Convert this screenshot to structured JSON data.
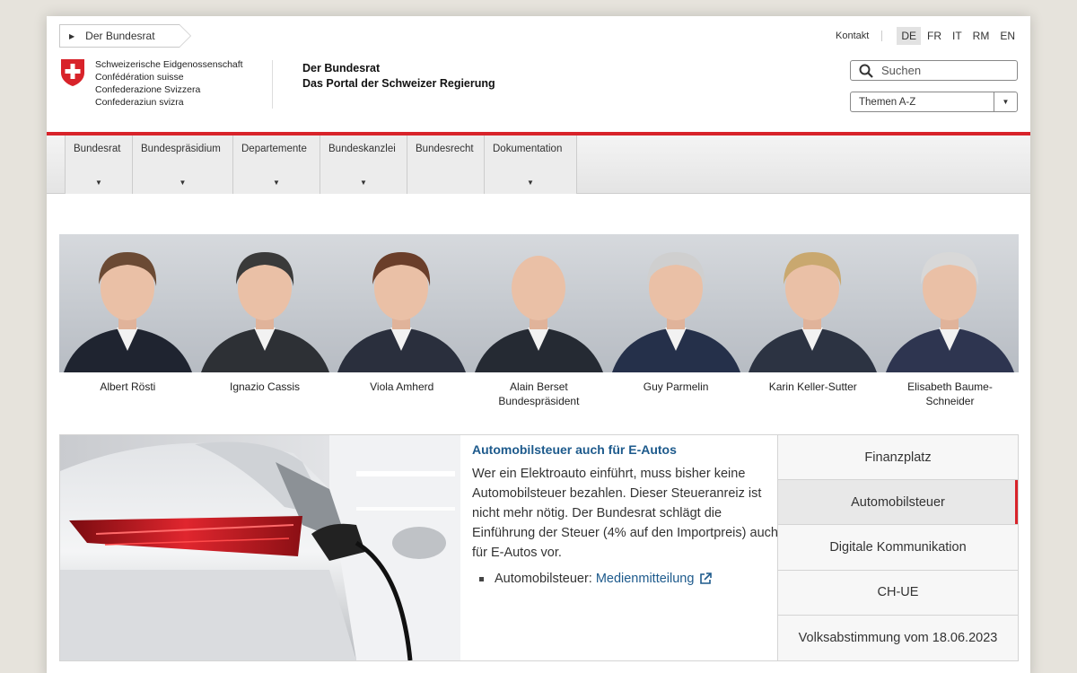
{
  "breadcrumb": {
    "label": "Der Bundesrat"
  },
  "confederation": {
    "lines": [
      "Schweizerische Eidgenossenschaft",
      "Confédération suisse",
      "Confederazione Svizzera",
      "Confederaziun svizra"
    ]
  },
  "portal": {
    "title": "Der Bundesrat",
    "subtitle": "Das Portal der Schweizer Regierung"
  },
  "header": {
    "contact": "Kontakt",
    "languages": [
      "DE",
      "FR",
      "IT",
      "RM",
      "EN"
    ],
    "active_language": "DE",
    "search_placeholder": "Suchen",
    "themes_select": "Themen A-Z"
  },
  "colors": {
    "accent_red": "#d8232a",
    "link_blue": "#1d5a8c"
  },
  "nav": {
    "items": [
      "Bundesrat",
      "Bundespräsidium",
      "Departemente",
      "Bundeskanzlei",
      "Bundesrecht",
      "Dokumentation"
    ]
  },
  "council": [
    {
      "name": "Albert Rösti",
      "role": ""
    },
    {
      "name": "Ignazio Cassis",
      "role": ""
    },
    {
      "name": "Viola Amherd",
      "role": ""
    },
    {
      "name": "Alain Berset",
      "role": "Bundespräsident"
    },
    {
      "name": "Guy Parmelin",
      "role": ""
    },
    {
      "name": "Karin Keller-Sutter",
      "role": ""
    },
    {
      "name": "Elisabeth Baume-Schneider",
      "role": ""
    }
  ],
  "feature": {
    "title": "Automobilsteuer auch für E-Autos",
    "body": "Wer ein Elektroauto einführt, muss bisher keine Automobilsteuer bezahlen. Dieser Steueranreiz ist nicht mehr nötig. Der Bundesrat schlägt die Einführung der Steuer (4% auf den Importpreis) auch für E-Autos vor.",
    "list_prefix": "Automobilsteuer:",
    "list_link": "Medienmitteilung"
  },
  "topics": [
    {
      "label": "Finanzplatz",
      "active": false
    },
    {
      "label": "Automobilsteuer",
      "active": true
    },
    {
      "label": "Digitale Kommunikation",
      "active": false
    },
    {
      "label": "CH-UE",
      "active": false
    },
    {
      "label": "Volksabstimmung vom 18.06.2023",
      "active": false
    }
  ]
}
